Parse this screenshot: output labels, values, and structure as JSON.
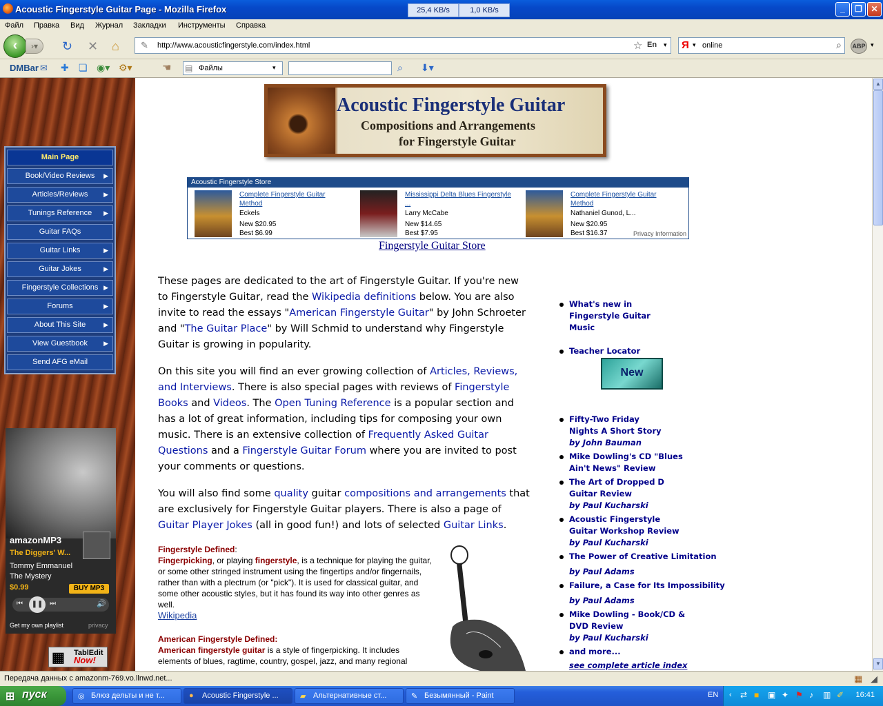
{
  "window": {
    "title": "Acoustic Fingerstyle Guitar Page - Mozilla Firefox",
    "download_speed": "25,4 KB/s",
    "upload_speed": "1,0 KB/s"
  },
  "menu": [
    "Файл",
    "Правка",
    "Вид",
    "Журнал",
    "Закладки",
    "Инструменты",
    "Справка"
  ],
  "nav": {
    "url": "http://www.acousticfingerstyle.com/index.html",
    "search_value": "online",
    "search_engine_logo": "Я",
    "lang_badge": "En",
    "abp_label": "ABP"
  },
  "dmbar": {
    "label": "DMBar",
    "files_select": "Файлы",
    "search_placeholder": ""
  },
  "sidebar": {
    "items": [
      {
        "label": "Main Page",
        "arrow": ""
      },
      {
        "label": "Book/Video Reviews",
        "arrow": "▶"
      },
      {
        "label": "Articles/Reviews",
        "arrow": "▶"
      },
      {
        "label": "Tunings Reference",
        "arrow": "▶"
      },
      {
        "label": "Guitar FAQs",
        "arrow": ""
      },
      {
        "label": "Guitar Links",
        "arrow": "▶"
      },
      {
        "label": "Guitar Jokes",
        "arrow": "▶"
      },
      {
        "label": "Fingerstyle Collections",
        "arrow": "▶"
      },
      {
        "label": "Forums",
        "arrow": "▶"
      },
      {
        "label": "About This Site",
        "arrow": "▶"
      },
      {
        "label": "View Guestbook",
        "arrow": "▶"
      },
      {
        "label": "Send AFG eMail",
        "arrow": ""
      }
    ],
    "amazon": {
      "brand": "amazonMP3",
      "song": "The Diggers' W...",
      "artist": "Tommy Emmanuel",
      "album": "The Mystery",
      "price": "$0.99",
      "buy": "BUY MP3",
      "playlist": "Get my own playlist",
      "privacy": "privacy"
    },
    "tabledit": {
      "line1": "TablEdit",
      "line2": "Now!"
    }
  },
  "logo": {
    "line1": "Acoustic Fingerstyle Guitar",
    "line2": "Compositions and Arrangements",
    "line3": "for Fingerstyle Guitar"
  },
  "store": {
    "header": "Acoustic Fingerstyle Store",
    "privacy": "Privacy Information",
    "link": "Fingerstyle Guitar Store",
    "products": [
      {
        "title": "Complete Fingerstyle Guitar Method",
        "author": "Eckels",
        "new": "New $20.95",
        "best": "Best $6.99"
      },
      {
        "title": "Mississippi Delta Blues Fingerstyle ...",
        "author": "Larry McCabe",
        "new": "New $14.65",
        "best": "Best $7.95"
      },
      {
        "title": "Complete Fingerstyle Guitar Method",
        "author": "Nathaniel Gunod, L...",
        "new": "New $20.95",
        "best": "Best $16.37"
      }
    ]
  },
  "intro": {
    "p1": {
      "a": "These pages are dedicated to the art of Fingerstyle Guitar.   If you're new to Fingerstyle Guitar, read the ",
      "l1": "Wikipedia definitions",
      "b": " below.  You are also invite to read the essays \"",
      "l2": "American Fingerstyle Guitar",
      "c": "\" by John Schroeter and \"",
      "l3": "The Guitar Place",
      "d": "\" by Will Schmid to understand why Fingerstyle Guitar is growing in popularity."
    },
    "p2": {
      "a": "On this site you will find an ever growing collection of ",
      "l1": "Articles, Reviews, and Interviews",
      "b": ".  There is also special pages with reviews of ",
      "l2": "Fingerstyle Books",
      "c": " and ",
      "l3": "Videos",
      "d": ".  The ",
      "l4": "Open Tuning Reference",
      "e": " is a popular section and has a lot of great information, including tips for composing your own music.  There is an extensive collection of ",
      "l5": "Frequently Asked Guitar Questions",
      "f": " and a ",
      "l6": "Fingerstyle Guitar Forum",
      "g": " where you are invited to post your comments or questions."
    },
    "p3": {
      "a": "You will also find some ",
      "l1": "quality",
      "b": " guitar ",
      "l2": "compositions and arrangements",
      "c": " that are exclusively for Fingerstyle Guitar players.  There is also a page of ",
      "l3": "Guitar Player Jokes",
      "d": " (all in good fun!) and lots of selected ",
      "l4": "Guitar Links",
      "e": "."
    }
  },
  "defs": {
    "h1": "Fingerstyle Defined",
    "h1colon": ":",
    "t1a": "Fingerpicking",
    "t1b": ", or playing ",
    "t1c": "fingerstyle",
    "t1d": ", is a technique for playing the guitar, or some other stringed instrument using the fingertips and/or fingernails, rather than with a plectrum (or \"pick\"). It is used for classical guitar, and some other acoustic styles, but it has found its way into other genres as well.",
    "wiki": "Wikipedia",
    "h2": "American Fingerstyle Defined:",
    "t2a": "American fingerstyle guitar",
    "t2b": " is a style of fingerpicking. It includes elements of blues, ragtime, country, gospel, jazz, and many regional"
  },
  "right": {
    "items": [
      {
        "l": "What's new in Fingerstyle Guitar Music",
        "by": ""
      },
      {
        "l": "Teacher Locator",
        "by": ""
      }
    ],
    "new_badge": "New",
    "articles": [
      {
        "l": "Fifty-Two Friday Nights A Short Story",
        "by": "by John Bauman"
      },
      {
        "l": "Mike Dowling's CD \"Blues Ain't News\" Review",
        "by": ""
      },
      {
        "l": "The Art of Dropped D Guitar Review",
        "by": "by Paul Kucharski"
      },
      {
        "l": "Acoustic Fingerstyle Guitar Workshop Review",
        "by": "by Paul Kucharski"
      },
      {
        "l": "The Power of Creative Limitation",
        "by": "by Paul Adams"
      },
      {
        "l": "Failure, a Case for Its Impossibility",
        "by": "by Paul Adams"
      },
      {
        "l": "Mike Dowling - Book/CD & DVD Review",
        "by": "by Paul Kucharski"
      },
      {
        "l": "and more...",
        "by": "see complete article index"
      }
    ]
  },
  "status": "Передача данных с amazonm-769.vo.llnwd.net...",
  "taskbar": {
    "start": "пуск",
    "tasks": [
      "Блюз дельты и не т...",
      "Acoustic Fingerstyle ...",
      "Альтернативные ст...",
      "Безымянный - Paint"
    ],
    "lang": "EN",
    "clock": "16:41"
  }
}
